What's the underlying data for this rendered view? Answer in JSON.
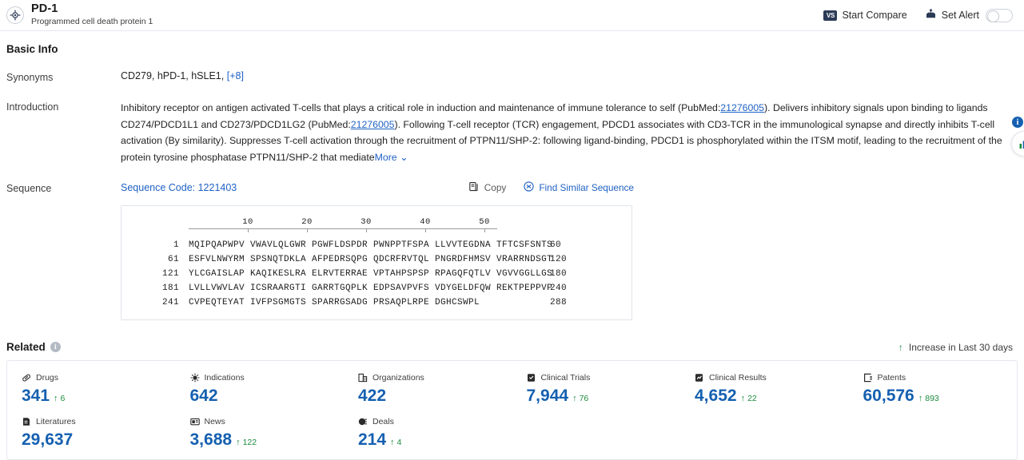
{
  "header": {
    "icon": "target-icon",
    "title": "PD-1",
    "subtitle": "Programmed cell death protein 1",
    "compare_badge": "VS",
    "compare_label": "Start Compare",
    "alert_icon": "bell-alert-icon",
    "alert_label": "Set Alert",
    "alert_toggle_state": "off"
  },
  "basic_info": {
    "section_title": "Basic Info",
    "synonyms_label": "Synonyms",
    "synonyms_value": "CD279,  hPD-1,  hSLE1,",
    "synonyms_more": "[+8]",
    "introduction_label": "Introduction",
    "introduction_p1": "Inhibitory receptor on antigen activated T-cells that plays a critical role in induction and maintenance of immune tolerance to self (PubMed:",
    "pubmed_1": "21276005",
    "introduction_p2": "). Delivers inhibitory signals upon binding to ligands CD274/PDCD1L1 and CD273/PDCD1LG2 (PubMed:",
    "pubmed_2": "21276005",
    "introduction_p3": "). Following T-cell receptor (TCR) engagement, PDCD1 associates with CD3-TCR in the immunological synapse and directly inhibits T-cell activation (By similarity). Suppresses T-cell activation through the recruitment of PTPN11/SHP-2: following ligand-binding, PDCD1 is phosphorylated within the ITSM motif, leading to the recruitment of the protein tyrosine phosphatase PTPN11/SHP-2 that mediate",
    "more_label": "More"
  },
  "sequence": {
    "label": "Sequence",
    "code_label": "Sequence Code: 1221403",
    "copy_icon": "copy-icon",
    "copy_label": "Copy",
    "similar_icon": "find-similar-icon",
    "similar_label": "Find Similar Sequence",
    "ruler_ticks": [
      "10",
      "20",
      "30",
      "40",
      "50"
    ],
    "rows": [
      {
        "start": "1",
        "chunks": "MQIPQAPWPV VWAVLQLGWR PGWFLDSPDR PWNPPTFSPA LLVVTEGDNA TFTCSFSNTS",
        "end": "60"
      },
      {
        "start": "61",
        "chunks": "ESFVLNWYRM SPSNQTDKLA AFPEDRSQPG QDCRFRVTQL PNGRDFHMSV VRARRNDSGT",
        "end": "120"
      },
      {
        "start": "121",
        "chunks": "YLCGAISLAP KAQIKESLRA ELRVTERRAE VPTAHPSPSP RPAGQFQTLV VGVVGGLLGS",
        "end": "180"
      },
      {
        "start": "181",
        "chunks": "LVLLVWVLAV ICSRAARGTI GARRTGQPLK EDPSAVPVFS VDYGELDFQW REKTPEPPVP",
        "end": "240"
      },
      {
        "start": "241",
        "chunks": "CVPEQTEYAT IVFPSGMGTS SPARRGSADG PRSAQPLRPE DGHCSWPL",
        "end": "288"
      }
    ]
  },
  "related": {
    "title": "Related",
    "info_icon": "info-icon",
    "increase_note": "Increase in Last 30 days",
    "stats": [
      {
        "label": "Drugs",
        "icon": "pill-icon",
        "value": "341",
        "delta": "6"
      },
      {
        "label": "Indications",
        "icon": "virus-icon",
        "value": "642",
        "delta": ""
      },
      {
        "label": "Organizations",
        "icon": "building-icon",
        "value": "422",
        "delta": ""
      },
      {
        "label": "Clinical Trials",
        "icon": "clinical-trial-icon",
        "value": "7,944",
        "delta": "76"
      },
      {
        "label": "Clinical Results",
        "icon": "clinical-result-icon",
        "value": "4,652",
        "delta": "22"
      },
      {
        "label": "Patents",
        "icon": "patent-icon",
        "value": "60,576",
        "delta": "893"
      },
      {
        "label": "Literatures",
        "icon": "literature-icon",
        "value": "29,637",
        "delta": ""
      },
      {
        "label": "News",
        "icon": "news-icon",
        "value": "3,688",
        "delta": "122"
      },
      {
        "label": "Deals",
        "icon": "deal-icon",
        "value": "214",
        "delta": "4"
      }
    ]
  },
  "rail": {
    "info_badge": "i",
    "chart_button_icon": "bar-chart-icon"
  },
  "colors": {
    "link": "#2062c4",
    "stat_number": "#1560b0",
    "increase": "#1a8c3c",
    "border": "#e4e7ed"
  }
}
